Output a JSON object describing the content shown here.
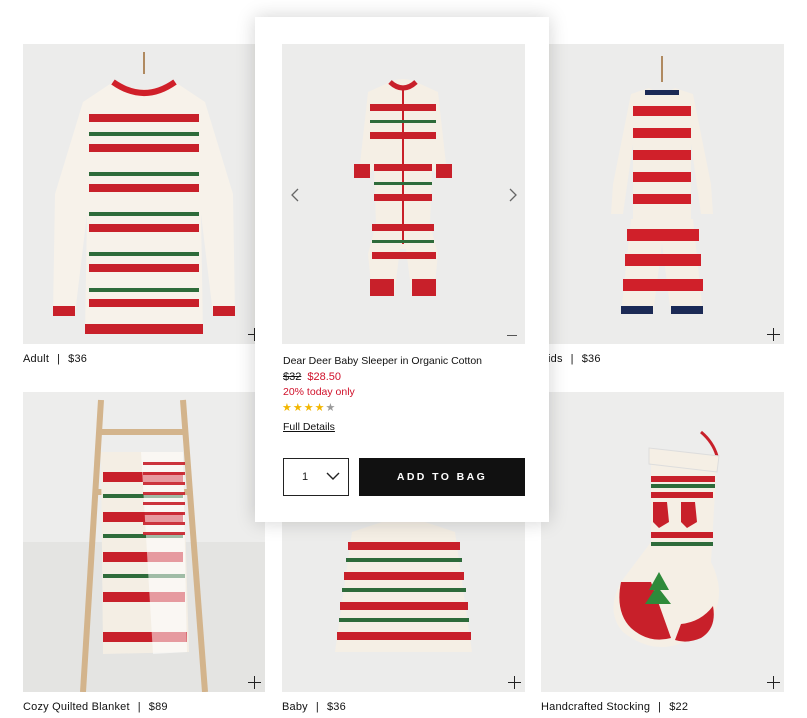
{
  "products": [
    {
      "name": "Adult",
      "price": "$36"
    },
    {
      "name": "ids",
      "price": "$36"
    },
    {
      "name": "Cozy Quilted Blanket",
      "price": "$89"
    },
    {
      "name": "Baby",
      "price": "$36"
    },
    {
      "name": "Handcrafted Stocking",
      "price": "$22"
    }
  ],
  "quickview": {
    "name": "Dear Deer Baby Sleeper in Organic Cotton",
    "old_price": "$32",
    "new_price": "$28.50",
    "promo": "20% today only",
    "rating": 4,
    "rating_max": 5,
    "details_link": "Full Details",
    "quantity": "1",
    "add_button": "ADD TO BAG"
  },
  "colors": {
    "sale": "#d0102a",
    "star": "#f2b600",
    "button": "#111111"
  }
}
